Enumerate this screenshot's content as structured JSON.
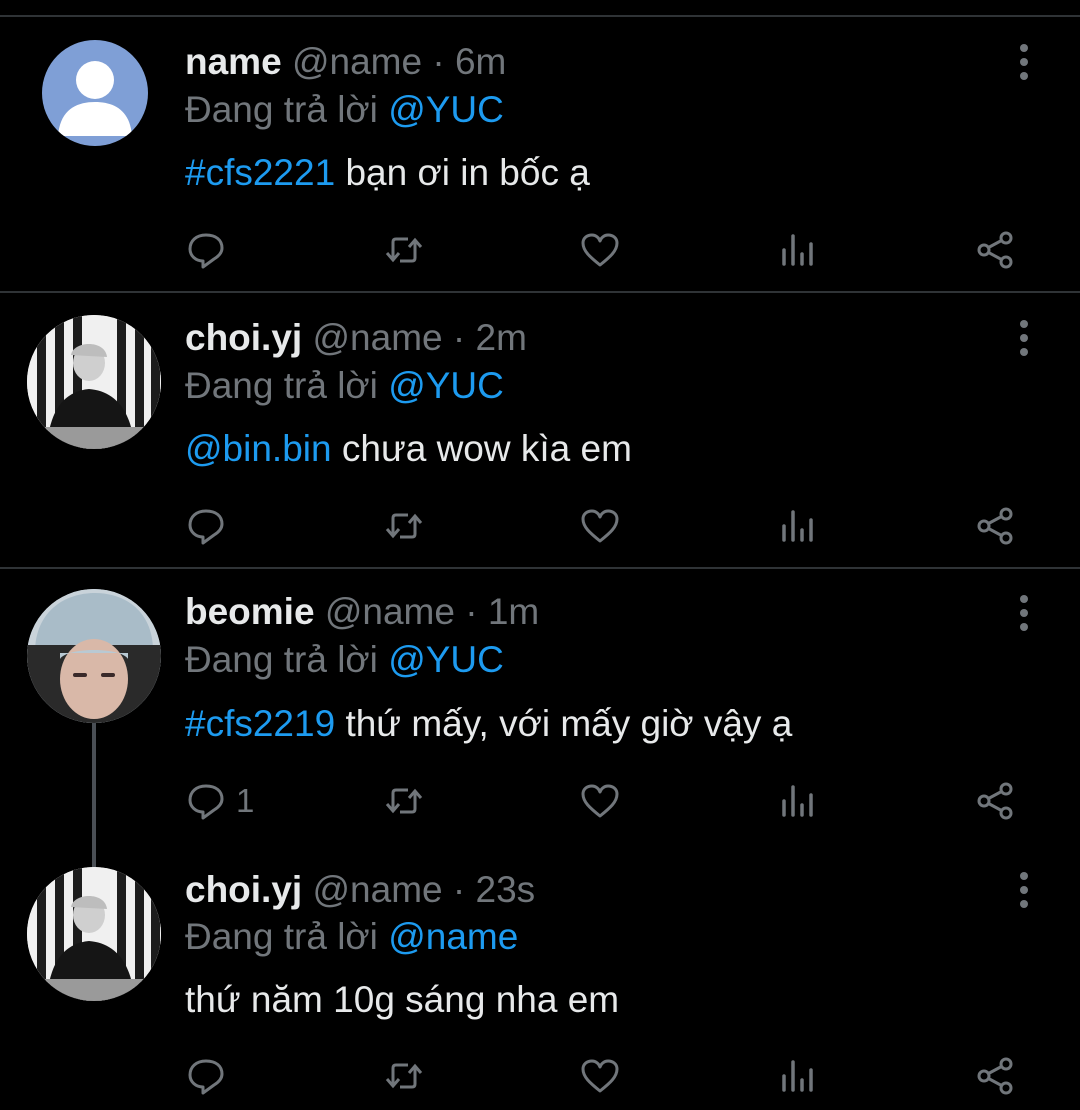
{
  "tweets": [
    {
      "name": "name",
      "handle": "@name",
      "sep": "·",
      "time": "6m",
      "reply_prefix": "Đang trả lời",
      "reply_to": "@YUC",
      "link": "#cfs2221",
      "text": " bạn ơi in bốc ạ",
      "reply_count": "",
      "avatar": "default-avatar"
    },
    {
      "name": "choi.yj",
      "handle": "@name",
      "sep": "·",
      "time": "2m",
      "reply_prefix": "Đang trả lời",
      "reply_to": "@YUC",
      "link": "@bin.bin",
      "text": " chưa wow kìa em",
      "reply_count": "",
      "avatar": "photo-avatar-choi"
    },
    {
      "name": "beomie",
      "handle": "@name",
      "sep": "·",
      "time": "1m",
      "reply_prefix": "Đang trả lời",
      "reply_to": "@YUC",
      "link": "#cfs2219",
      "text": " thứ mấy, với mấy giờ vậy ạ",
      "reply_count": "1",
      "avatar": "photo-avatar-beomie"
    },
    {
      "name": "choi.yj",
      "handle": "@name",
      "sep": "·",
      "time": "23s",
      "reply_prefix": "Đang trả lời",
      "reply_to": "@name",
      "link": "",
      "text": "thứ năm 10g sáng nha em",
      "reply_count": "",
      "avatar": "photo-avatar-choi"
    }
  ],
  "icons": [
    "reply-icon",
    "retweet-icon",
    "like-icon",
    "views-icon",
    "share-icon",
    "more-icon"
  ],
  "colors": {
    "background": "#000000",
    "text": "#e7e9ea",
    "muted": "#71767b",
    "accent": "#1d9bf0",
    "divider": "#2f3336"
  }
}
